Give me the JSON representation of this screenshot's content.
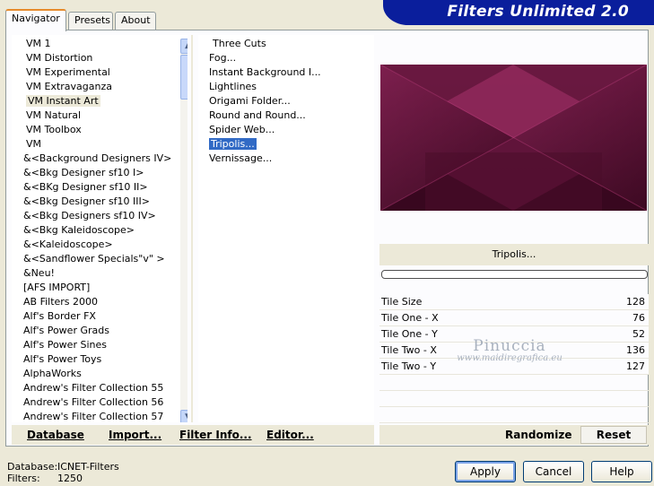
{
  "banner": {
    "title": "Filters Unlimited 2.0"
  },
  "tabs": [
    {
      "label": "Navigator",
      "active": true
    },
    {
      "label": "Presets",
      "active": false
    },
    {
      "label": "About",
      "active": false
    }
  ],
  "categories": [
    "VM 1",
    "VM Distortion",
    "VM Experimental",
    "VM Extravaganza",
    "VM Instant Art",
    "VM Natural",
    "VM Toolbox",
    "VM",
    "&<Background Designers IV>",
    "&<Bkg Designer sf10 I>",
    "&<BKg Designer sf10 II>",
    "&<Bkg Designer sf10 III>",
    "&<Bkg Designers sf10 IV>",
    "&<Bkg Kaleidoscope>",
    "&<Kaleidoscope>",
    "&<Sandflower Specials\"v\" >",
    "&Neu!",
    "[AFS IMPORT]",
    "AB Filters 2000",
    "Alf's Border FX",
    "Alf's Power Grads",
    "Alf's Power Sines",
    "Alf's Power Toys",
    "AlphaWorks",
    "Andrew's Filter Collection 55",
    "Andrew's Filter Collection 56",
    "Andrew's Filter Collection 57"
  ],
  "selected_category_index": 4,
  "filters": [
    "Three Cuts",
    "Fog...",
    "Instant Background I...",
    "Lightlines",
    "Origami Folder...",
    "Round and Round...",
    "Spider Web...",
    "Tripolis...",
    "Vernissage..."
  ],
  "selected_filter_index": 7,
  "preview": {
    "filter_title": "Tripolis..."
  },
  "params": [
    {
      "name": "Tile Size",
      "value": "128"
    },
    {
      "name": "Tile One - X",
      "value": "76"
    },
    {
      "name": "Tile One - Y",
      "value": "52"
    },
    {
      "name": "Tile Two - X",
      "value": "136"
    },
    {
      "name": "Tile Two - Y",
      "value": "127"
    }
  ],
  "watermark": {
    "name": "Pinuccia",
    "url": "www.maidiregrafica.eu"
  },
  "toolbar": {
    "database": "Database",
    "import": "Import...",
    "filter_info": "Filter Info...",
    "editor": "Editor...",
    "randomize": "Randomize",
    "reset": "Reset"
  },
  "status": {
    "database_label": "Database:",
    "database_value": "ICNET-Filters",
    "filters_label": "Filters:",
    "filters_value": "1250"
  },
  "dialog": {
    "apply": "Apply",
    "cancel": "Cancel",
    "help": "Help"
  },
  "colors": {
    "banner": "#0a1e9c",
    "selection": "#316ac5",
    "preview_base": "#3c0a22",
    "preview_accent": "#9a2a62"
  }
}
